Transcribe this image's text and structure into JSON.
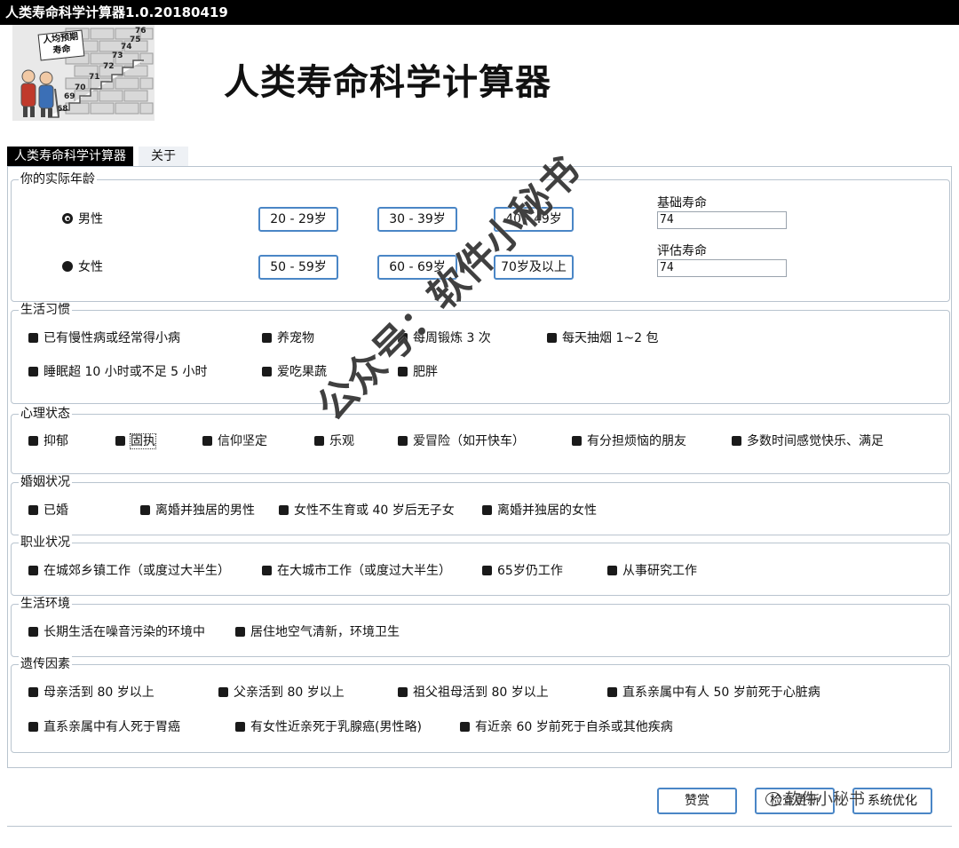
{
  "window": {
    "title": "人类寿命科学计算器1.0.20180419"
  },
  "header": {
    "heading": "人类寿命科学计算器",
    "logo": {
      "sign": [
        "人均预期",
        "寿命"
      ],
      "numbers": [
        "76",
        "75",
        "74",
        "73",
        "72",
        "71",
        "70",
        "69",
        "68"
      ]
    }
  },
  "tabs": [
    {
      "label": "人类寿命科学计算器",
      "active": true
    },
    {
      "label": "关于",
      "active": false
    }
  ],
  "age": {
    "title": "你的实际年龄",
    "gender": [
      {
        "label": "男性",
        "selected": true
      },
      {
        "label": "女性",
        "selected": false
      }
    ],
    "ranges": [
      "20 - 29岁",
      "30 - 39岁",
      "40 - 49岁",
      "50 - 59岁",
      "60 - 69岁",
      "70岁及以上"
    ],
    "base_label": "基础寿命",
    "base_value": "74",
    "est_label": "评估寿命",
    "est_value": "74"
  },
  "groups": {
    "habits": {
      "title": "生活习惯",
      "items": [
        "已有慢性病或经常得小病",
        "养宠物",
        "每周锻炼 3 次",
        "每天抽烟 1~2 包",
        "睡眠超 10 小时或不足 5 小时",
        "爱吃果蔬",
        "肥胖"
      ]
    },
    "mental": {
      "title": "心理状态",
      "items": [
        "抑郁",
        "固执",
        "信仰坚定",
        "乐观",
        "爱冒险（如开快车）",
        "有分担烦恼的朋友",
        "多数时间感觉快乐、满足"
      ]
    },
    "marriage": {
      "title": "婚姻状况",
      "items": [
        "已婚",
        "离婚并独居的男性",
        "女性不生育或 40 岁后无子女",
        "离婚并独居的女性"
      ]
    },
    "career": {
      "title": "职业状况",
      "items": [
        "在城郊乡镇工作（或度过大半生）",
        "在大城市工作（或度过大半生）",
        "65岁仍工作",
        "从事研究工作"
      ]
    },
    "environment": {
      "title": "生活环境",
      "items": [
        "长期生活在噪音污染的环境中",
        "居住地空气清新，环境卫生"
      ]
    },
    "genetics": {
      "title": "遗传因素",
      "items": [
        "母亲活到 80 岁以上",
        "父亲活到 80 岁以上",
        "祖父祖母活到 80 岁以上",
        "直系亲属中有人 50 岁前死于心脏病",
        "直系亲属中有人死于胃癌",
        "有女性近亲死于乳腺癌(男性略)",
        "有近亲 60 岁前死于自杀或其他疾病"
      ]
    }
  },
  "buttons": [
    "赞赏",
    "检查更新",
    "系统优化"
  ],
  "watermark": "公众号：软件小秘书",
  "corner_watermark": "软件小秘书"
}
